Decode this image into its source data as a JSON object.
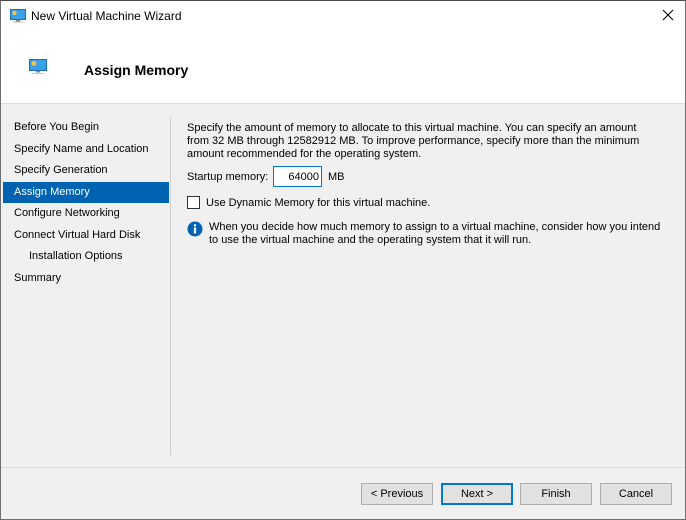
{
  "window": {
    "title": "New Virtual Machine Wizard",
    "icon": "monitor-icon",
    "close_icon": "close-icon"
  },
  "header": {
    "title": "Assign Memory",
    "icon": "monitor-icon"
  },
  "nav": {
    "items": [
      {
        "label": "Before You Begin",
        "selected": false,
        "indent": false
      },
      {
        "label": "Specify Name and Location",
        "selected": false,
        "indent": false
      },
      {
        "label": "Specify Generation",
        "selected": false,
        "indent": false
      },
      {
        "label": "Assign Memory",
        "selected": true,
        "indent": false
      },
      {
        "label": "Configure Networking",
        "selected": false,
        "indent": false
      },
      {
        "label": "Connect Virtual Hard Disk",
        "selected": false,
        "indent": false
      },
      {
        "label": "Installation Options",
        "selected": false,
        "indent": true
      },
      {
        "label": "Summary",
        "selected": false,
        "indent": false
      }
    ]
  },
  "content": {
    "description": "Specify the amount of memory to allocate to this virtual machine. You can specify an amount from 32 MB through 12582912 MB. To improve performance, specify more than the minimum amount recommended for the operating system.",
    "startup_memory": {
      "label": "Startup memory:",
      "value": "64000",
      "unit": "MB"
    },
    "dynamic_memory": {
      "label": "Use Dynamic Memory for this virtual machine.",
      "checked": false
    },
    "info": {
      "icon": "info-icon",
      "text": "When you decide how much memory to assign to a virtual machine, consider how you intend to use the virtual machine and the operating system that it will run."
    }
  },
  "buttons": {
    "previous": "< Previous",
    "next": "Next >",
    "finish": "Finish",
    "cancel": "Cancel"
  },
  "colors": {
    "accent": "#0063b1",
    "focus_border": "#0078d7",
    "info_icon": "#0063b1"
  }
}
